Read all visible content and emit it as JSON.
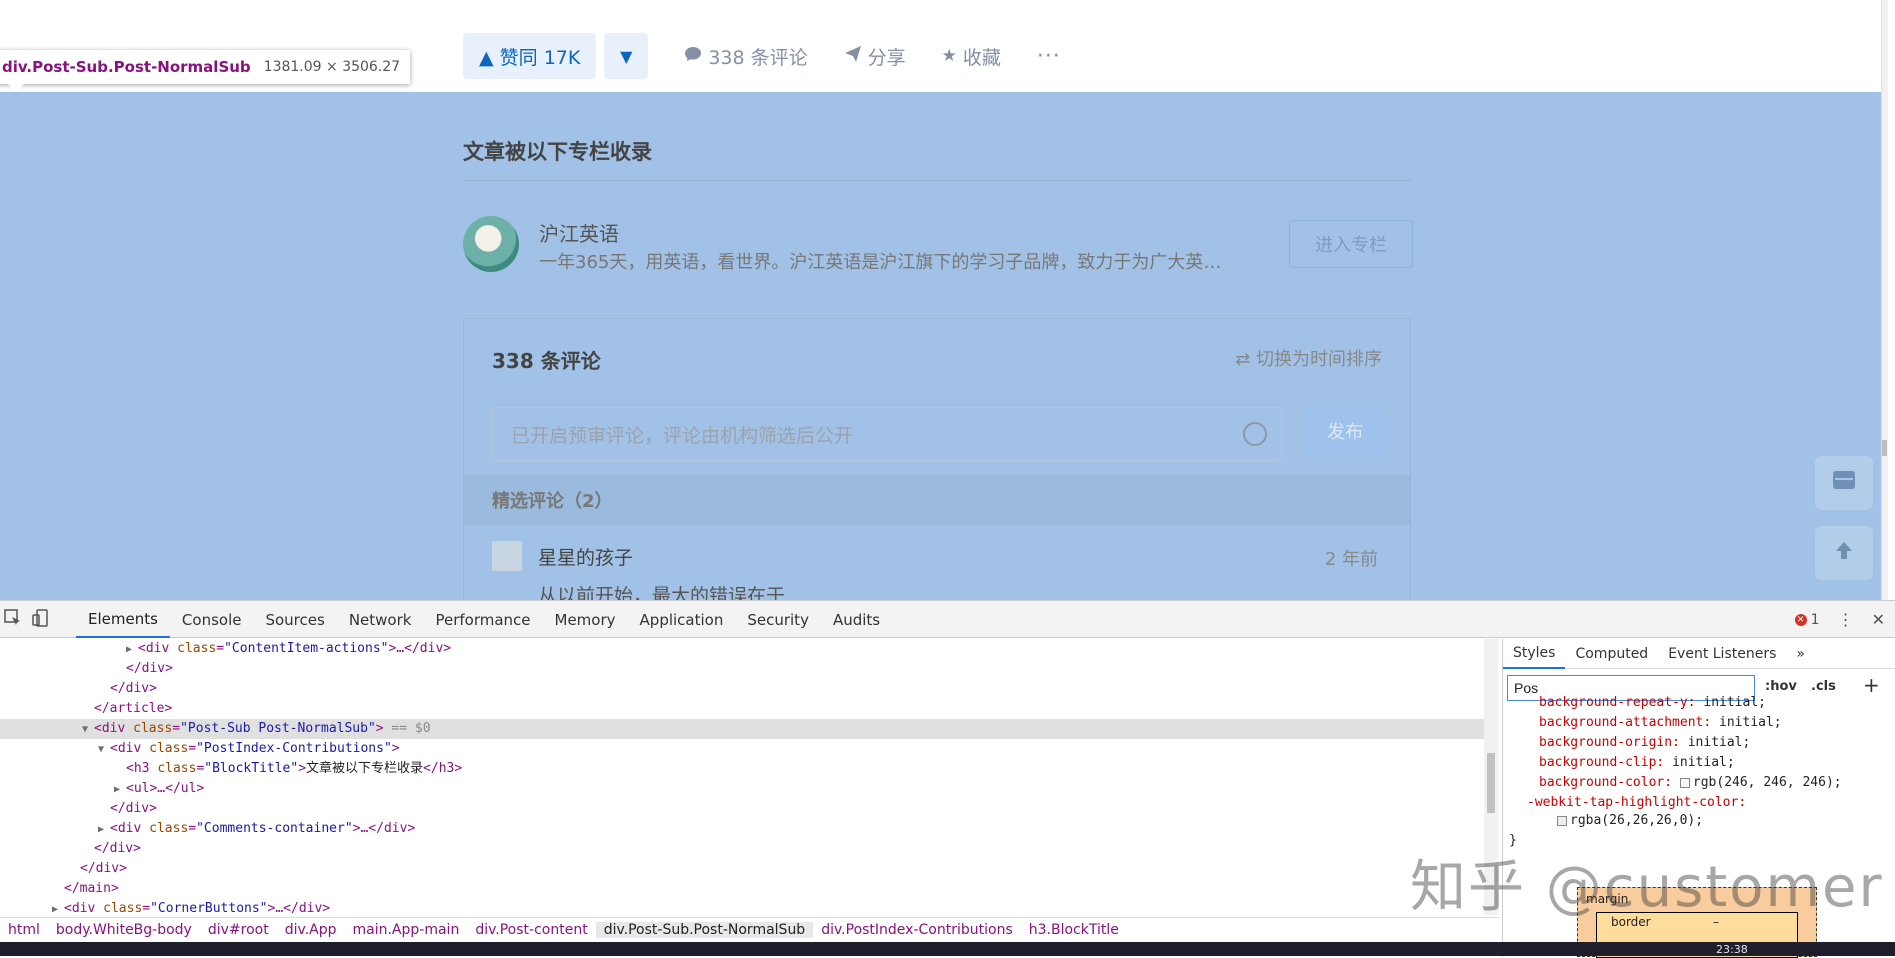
{
  "actions": {
    "vote_up": "▲ 赞同 17K",
    "vote_down": "▼",
    "comments": "338 条评论",
    "share": "分享",
    "favorite": "收藏",
    "more": "···"
  },
  "tooltip": {
    "selector": "div.Post-Sub.Post-NormalSub",
    "size": "1381.09 × 3506.27"
  },
  "column": {
    "block_title": "文章被以下专栏收录",
    "name": "沪江英语",
    "desc": "一年365天，用英语，看世界。沪江英语是沪江旗下的学习子品牌，致力于为广大英…",
    "enter_button": "进入专栏"
  },
  "comments": {
    "count_title": "338 条评论",
    "sort": "⇄ 切换为时间排序",
    "input_placeholder": "已开启预审评论，评论由机构筛选后公开",
    "submit": "发布",
    "featured": "精选评论（2）",
    "first": {
      "name": "星星的孩子",
      "time": "2 年前",
      "text": "从以前开始，最大的错误在于"
    }
  },
  "devtools": {
    "tabs": [
      "Elements",
      "Console",
      "Sources",
      "Network",
      "Performance",
      "Memory",
      "Application",
      "Security",
      "Audits"
    ],
    "error_count": "1",
    "dom": {
      "l0": {
        "tag_open": "<div",
        "attr": "class",
        "val": "\"ContentItem-actions\"",
        "rest": ">…</div>"
      },
      "l1": "</div>",
      "l2": "</div>",
      "l3": "</article>",
      "l4": {
        "tag_open": "<div",
        "attr": "class",
        "val": "\"Post-Sub Post-NormalSub\"",
        "rest": ">",
        "eq": " == $0"
      },
      "l5": {
        "tag_open": "<div",
        "attr": "class",
        "val": "\"PostIndex-Contributions\"",
        "rest": ">"
      },
      "l6": {
        "tag_open": "<h3",
        "attr": "class",
        "val": "\"BlockTitle\"",
        "rest": ">",
        "text": "文章被以下专栏收录",
        "close": "</h3>"
      },
      "l7": "<ul>…</ul>",
      "l8": "</div>",
      "l9": {
        "tag_open": "<div",
        "attr": "class",
        "val": "\"Comments-container\"",
        "rest": ">…</div>"
      },
      "l10": "</div>",
      "l11": "</div>",
      "l12": "</main>",
      "l13": {
        "tag_open": "<div",
        "attr": "class",
        "val": "\"CornerButtons\"",
        "rest": ">…</div>"
      }
    },
    "breadcrumbs": [
      "html",
      "body.WhiteBg-body",
      "div#root",
      "div.App",
      "main.App-main",
      "div.Post-content",
      "div.Post-Sub.Post-NormalSub",
      "div.PostIndex-Contributions",
      "h3.BlockTitle"
    ],
    "styles": {
      "tabs": [
        "Styles",
        "Computed",
        "Event Listeners",
        "»"
      ],
      "filter_value": "Pos",
      "hov": ":hov",
      "cls": ".cls",
      "plus": "+",
      "props": [
        {
          "name": "background-repeat-y:",
          "value": "initial;"
        },
        {
          "name": "background-attachment:",
          "value": "initial;"
        },
        {
          "name": "background-origin:",
          "value": "initial;"
        },
        {
          "name": "background-clip:",
          "value": "initial;"
        },
        {
          "name": "background-color:",
          "value": "rgb(246, 246, 246);"
        },
        {
          "name": "-webkit-tap-highlight-color:",
          "value": ""
        },
        {
          "name": "",
          "value": "rgba(26,26,26,0);"
        }
      ],
      "close_brace": "}",
      "box_margin": "margin",
      "box_border": "border",
      "box_dash": "–"
    }
  },
  "watermark": "知乎 @customer",
  "taskbar_time": "23:38",
  "colors": {
    "accent": "#0a66c2",
    "highlight_overlay": "#6fa1d8",
    "devtools_tab_active": "#1a73e8"
  }
}
